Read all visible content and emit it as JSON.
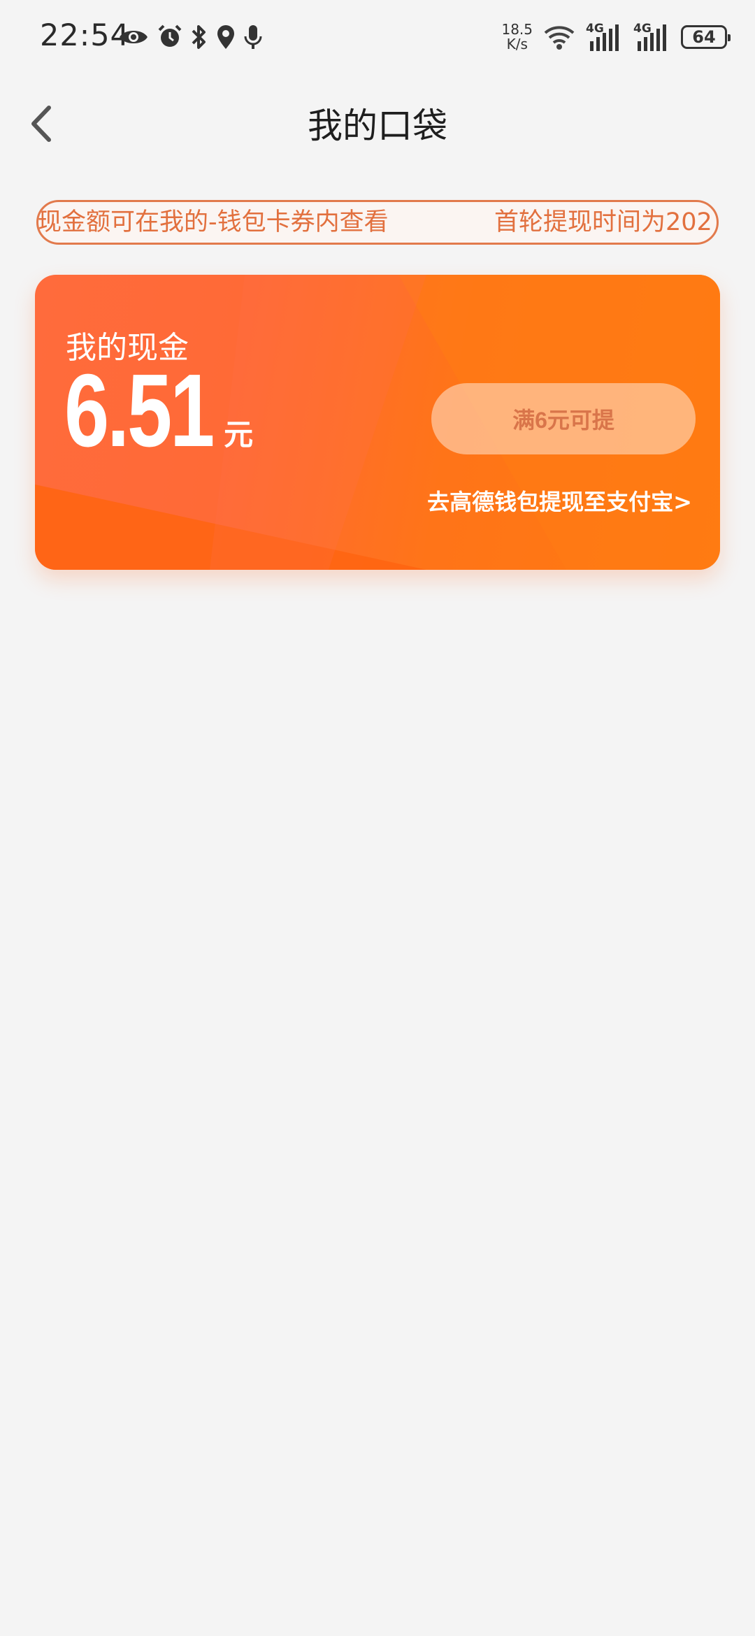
{
  "status_bar": {
    "time": "22:54",
    "icons": [
      "eye-icon",
      "alarm-icon",
      "bluetooth-icon",
      "location-icon",
      "mic-icon"
    ],
    "net_speed_value": "18.5",
    "net_speed_unit": "K/s",
    "sim1_label": "4G",
    "sim2_label": "4G",
    "battery": "64"
  },
  "header": {
    "title": "我的口袋"
  },
  "notice": {
    "message_1": "现金额可在我的-钱包卡券内查看",
    "message_2": "首轮提现时间为202"
  },
  "cash_card": {
    "label": "我的现金",
    "amount": "6.51",
    "unit": "元",
    "withdraw_button": "满6元可提",
    "link": "去高德钱包提现至支付宝>"
  },
  "colors": {
    "accent": "#ff6a2a",
    "notice_text": "#e2703e",
    "background": "#f4f4f4"
  }
}
